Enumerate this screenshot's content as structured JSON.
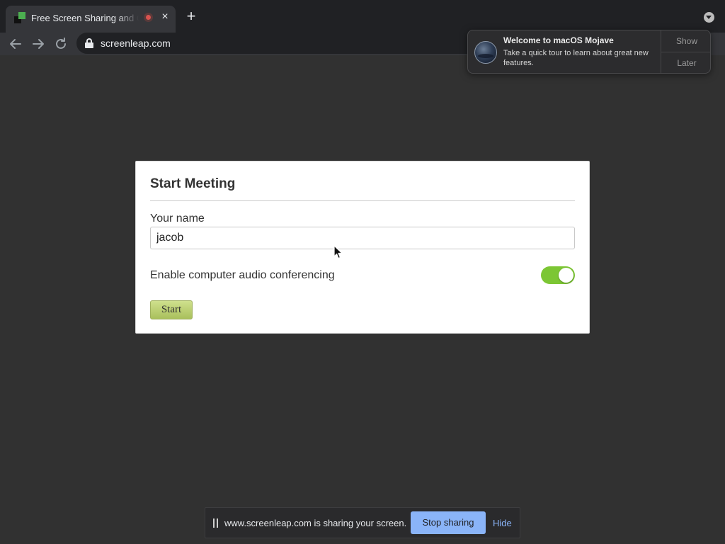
{
  "browser": {
    "tab": {
      "title": "Free Screen Sharing and Online Meetings",
      "favicon": "screenleap-favicon",
      "recording_icon": "recording-icon",
      "close_glyph": "×"
    },
    "new_tab_glyph": "+",
    "url": "screenleap.com"
  },
  "notification": {
    "icon": "macos-mojave-icon",
    "title": "Welcome to macOS Mojave",
    "body": "Take a quick tour to learn about great new features.",
    "actions": {
      "show": "Show",
      "later": "Later"
    }
  },
  "dialog": {
    "title": "Start Meeting",
    "name_label": "Your name",
    "name_value": "jacob",
    "audio_label": "Enable computer audio conferencing",
    "audio_enabled": true,
    "start_label": "Start"
  },
  "share_bar": {
    "message": "www.screenleap.com is sharing your screen.",
    "stop_label": "Stop sharing",
    "hide_label": "Hide"
  },
  "colors": {
    "page_background": "#313131",
    "toggle_on": "#7cc634",
    "start_button": "#b8cc70",
    "stop_button": "#8ab4f8"
  }
}
